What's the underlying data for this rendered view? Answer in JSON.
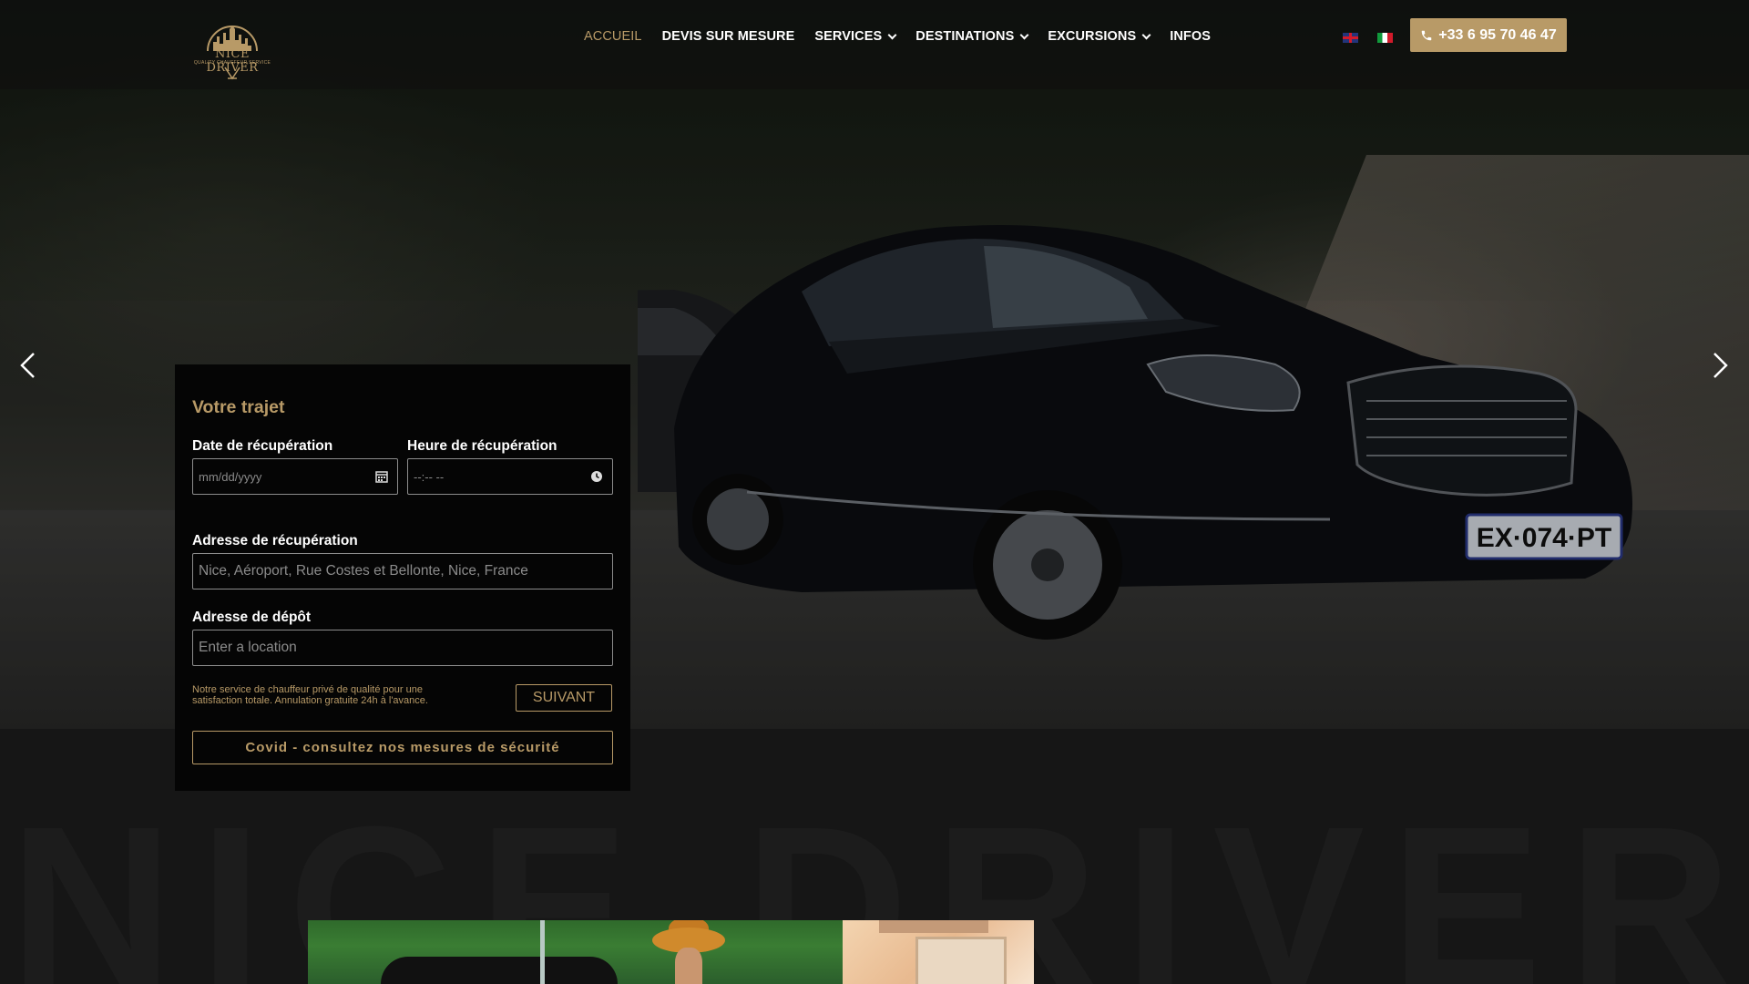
{
  "header": {
    "logo": {
      "name": "NICE DRIVER",
      "tagline": "QUALITY CHAUFFEUR SERVICE"
    },
    "nav": [
      {
        "label": "ACCUEIL",
        "active": true,
        "has_dropdown": false
      },
      {
        "label": "DEVIS SUR MESURE",
        "active": false,
        "has_dropdown": false
      },
      {
        "label": "SERVICES",
        "active": false,
        "has_dropdown": true
      },
      {
        "label": "DESTINATIONS",
        "active": false,
        "has_dropdown": true
      },
      {
        "label": "EXCURSIONS",
        "active": false,
        "has_dropdown": true
      },
      {
        "label": "INFOS",
        "active": false,
        "has_dropdown": false
      }
    ],
    "languages": [
      "english-flag-icon",
      "italian-flag-icon"
    ],
    "phone": "+33 6 95 70 46 47"
  },
  "booking": {
    "title": "Votre trajet",
    "pickup_date": {
      "label": "Date de récupération",
      "placeholder": "mm/dd/yyyy"
    },
    "pickup_time": {
      "label": "Heure de récupération",
      "placeholder": "--:-- --"
    },
    "pickup_address": {
      "label": "Adresse de récupération",
      "value": "Nice, Aéroport, Rue Costes et Bellonte, Nice, France"
    },
    "dropoff_address": {
      "label": "Adresse de dépôt",
      "placeholder": "Enter a location"
    },
    "note": "Notre service de chauffeur privé de qualité pour une satisfaction totale. Annulation gratuite 24h à l'avance.",
    "next_label": "SUIVANT",
    "covid_label": "Covid - consultez nos mesures de sécurité"
  },
  "watermark": "NICE DRIVER",
  "colors": {
    "accent": "#b89a67",
    "background": "#161616",
    "panel": "#050505"
  }
}
